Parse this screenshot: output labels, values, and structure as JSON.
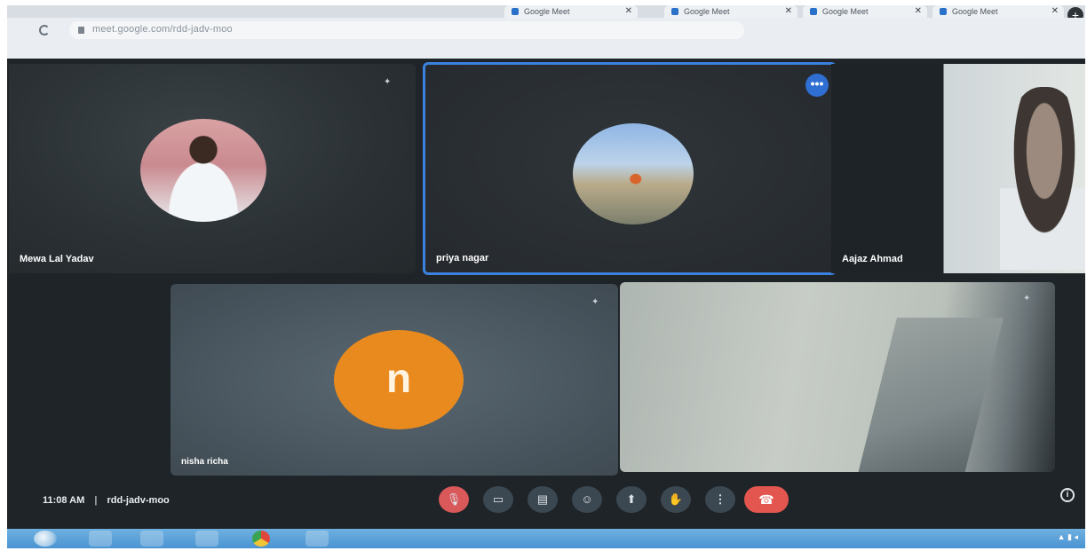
{
  "browser": {
    "tabs": [
      {
        "title": "Google Meet"
      },
      {
        "title": "Google Meet"
      },
      {
        "title": "Google Meet"
      },
      {
        "title": "Google Meet"
      }
    ],
    "url": "meet.google.com/rdd-jadv-moo",
    "new_tab_label": "+"
  },
  "participants": [
    {
      "name": "Mewa Lal Yadav"
    },
    {
      "name": "priya nagar"
    },
    {
      "name": "Aajaz Ahmad"
    },
    {
      "name": "nisha richa",
      "avatar_letter": "n",
      "avatar_color": "#e98a1e"
    }
  ],
  "meeting": {
    "time": "11:08 AM",
    "separator": "|",
    "code": "rdd-jadv-moo"
  },
  "controls": {
    "mic_icon": "mic-off-icon",
    "camera_icon": "camera-icon",
    "captions_icon": "captions-icon",
    "emoji_icon": "emoji-icon",
    "present_icon": "present-icon",
    "hand_icon": "raise-hand-icon",
    "more_icon": "more-options-icon",
    "leave_icon": "leave-call-icon"
  },
  "colors": {
    "accent_blue": "#3b82e0",
    "leave_red": "#e3564f",
    "avatar_orange": "#e98a1e"
  }
}
